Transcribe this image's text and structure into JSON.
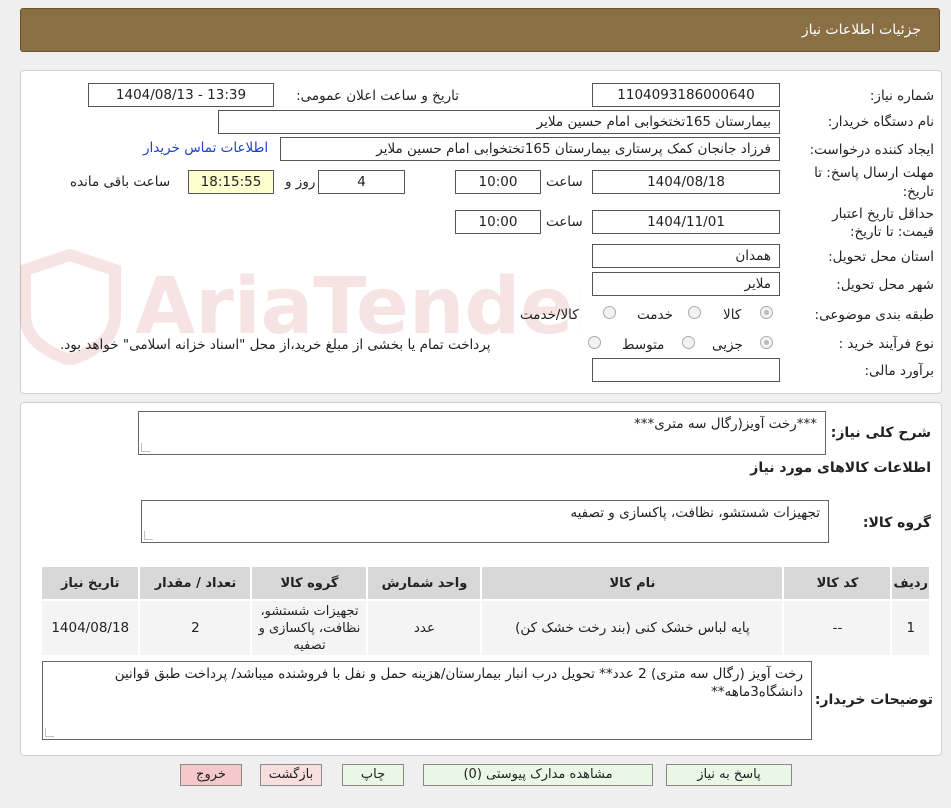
{
  "header": {
    "title": "جزئيات اطلاعات نياز"
  },
  "form": {
    "need_number_label": "شماره نیاز:",
    "need_number": "1104093186000640",
    "announce_label": "تاریخ و ساعت اعلان عمومی:",
    "announce_value": "1404/08/13 - 13:39",
    "buyer_org_label": "نام دستگاه خریدار:",
    "buyer_org": "بیمارستان 165تختخوابی امام حسین ملایر",
    "creator_label": "ایجاد کننده درخواست:",
    "creator": "فرزاد جانجان کمک پرستاری بیمارستان 165تختخوابی امام حسین ملایر",
    "contact_link": "اطلاعات تماس خریدار",
    "deadline_label_1": "مهلت ارسال پاسخ: تا",
    "deadline_label_2": "تاریخ:",
    "deadline_date": "1404/08/18",
    "time_label": "ساعت",
    "deadline_time": "10:00",
    "days_value": "4",
    "days_label": "روز و",
    "remaining_time": "18:15:55",
    "remaining_label": "ساعت باقی مانده",
    "validity_label_1": "حداقل تاریخ اعتبار",
    "validity_label_2": "قیمت: تا تاریخ:",
    "validity_date": "1404/11/01",
    "validity_time": "10:00",
    "province_label": "استان محل تحویل:",
    "province": "همدان",
    "city_label": "شهر محل تحویل:",
    "city": "ملایر",
    "category_label": "طبقه بندی موضوعی:",
    "category_options": [
      "کالا",
      "خدمت",
      "کالا/خدمت"
    ],
    "process_label": "نوع فرآیند خرید :",
    "process_options": [
      "جزیی",
      "متوسط"
    ],
    "process_note": "پرداخت تمام یا بخشی از مبلغ خرید،از محل \"اسناد خزانه اسلامی\" خواهد بود.",
    "estimate_label": "برآورد مالی:",
    "estimate_value": ""
  },
  "details": {
    "summary_label": "شرح کلی نیاز:",
    "summary_value": "***رخت آویز(رگال سه متری***",
    "goods_info_title": "اطلاعات کالاهای مورد نیاز",
    "goods_group_label": "گروه کالا:",
    "goods_group_value": "تجهیزات شستشو، نظافت، پاکسازی و تصفیه",
    "table_headers": [
      "ردیف",
      "کد کالا",
      "نام کالا",
      "واحد شمارش",
      "گروه کالا",
      "تعداد / مقدار",
      "تاریخ نیاز"
    ],
    "table_rows": [
      [
        "1",
        "--",
        "پایه لباس خشک کنی (بند رخت خشک کن)",
        "عدد",
        "تجهیزات شستشو، نظافت، پاکسازی و تصفیه",
        "2",
        "1404/08/18"
      ]
    ],
    "buyer_notes_label": "توضیحات خریدار:",
    "buyer_notes": "رخت آویز (رگال سه متری) 2 عدد** تحویل درب انبار بیمارستان/هزینه حمل و نفل با فروشنده میباشد/ پرداخت طبق قوانین دانشگاه3ماهه**"
  },
  "buttons": {
    "reply": "پاسخ به نیاز",
    "attachments": "مشاهده مدارک پیوستی (0)",
    "print": "چاپ",
    "back": "بازگشت",
    "exit": "خروج"
  },
  "watermark": {
    "text": "AriaTender.neT"
  },
  "colors": {
    "header_bg": "#8a6e44",
    "link": "#1a3fd1",
    "remaining_bg": "#ffffd0"
  }
}
